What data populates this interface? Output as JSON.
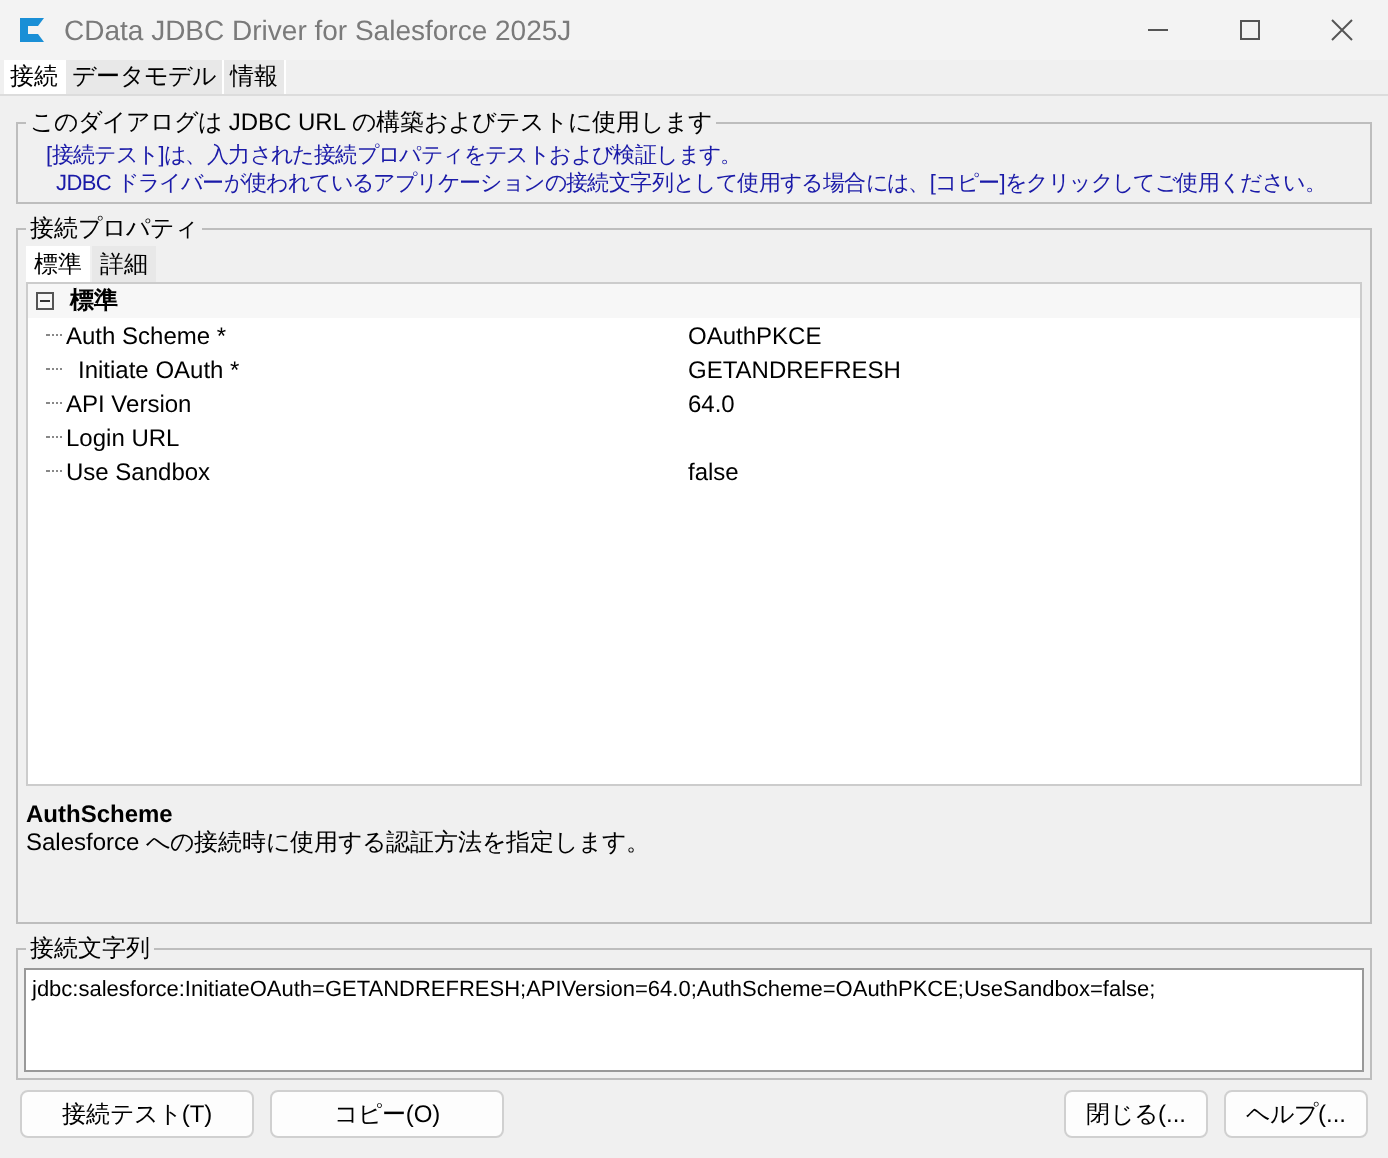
{
  "window": {
    "title": "CData JDBC Driver for Salesforce 2025J"
  },
  "tabs": [
    {
      "label": "接続",
      "selected": true
    },
    {
      "label": "データモデル",
      "selected": false
    },
    {
      "label": "情報",
      "selected": false
    }
  ],
  "intro_group": {
    "legend": "このダイアログは JDBC URL の構築およびテストに使用します",
    "lines": [
      "[接続テスト]は、入力された接続プロパティをテストおよび検証します。",
      "JDBC ドライバーが使われているアプリケーションの接続文字列として使用する場合には、[コピー]をクリックしてご使用ください。"
    ]
  },
  "properties_group": {
    "legend": "接続プロパティ",
    "tabs": [
      {
        "label": "標準",
        "selected": true
      },
      {
        "label": "詳細",
        "selected": false
      }
    ],
    "categories": [
      {
        "label": "標準",
        "expanded": true,
        "items": [
          {
            "name": "Auth Scheme *",
            "value": "OAuthPKCE",
            "children": [
              {
                "name": "Initiate OAuth *",
                "value": "GETANDREFRESH"
              }
            ]
          },
          {
            "name": "API Version",
            "value": "64.0"
          },
          {
            "name": "Login URL"
          },
          {
            "name": "Use Sandbox",
            "value": "false"
          }
        ]
      }
    ],
    "description": {
      "title": "AuthScheme",
      "text": "Salesforce への接続時に使用する認証方法を指定します。"
    }
  },
  "connection_string_group": {
    "legend": "接続文字列",
    "value": "jdbc:salesforce:InitiateOAuth=GETANDREFRESH;APIVersion=64.0;AuthScheme=OAuthPKCE;UseSandbox=false;"
  },
  "buttons_left": [
    {
      "label": "接続テスト(T)"
    },
    {
      "label": "コピー(O)"
    }
  ],
  "buttons_right": [
    {
      "label": "閉じる(..."
    },
    {
      "label": "ヘルプ(..."
    }
  ]
}
